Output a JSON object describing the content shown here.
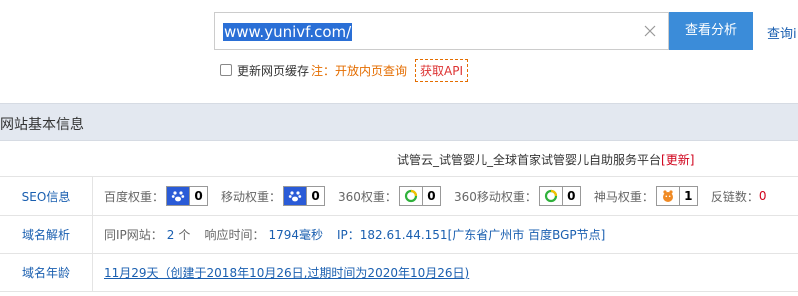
{
  "search": {
    "value": "www.yunivf.com/",
    "button_label": "查看分析",
    "query_link": "查询i"
  },
  "options": {
    "cache_label": "更新网页缓存",
    "note": "注：开放内页查询",
    "api_label": "获取API"
  },
  "section": {
    "title": "网站基本信息"
  },
  "site": {
    "title": "试管云_试管婴儿_全球首家试管婴儿自助服务平台",
    "update_label": "[更新]"
  },
  "seo": {
    "label": "SEO信息",
    "metrics": [
      {
        "label": "百度权重：",
        "icon": "paw-icon",
        "value": "0"
      },
      {
        "label": "移动权重：",
        "icon": "paw-icon",
        "value": "0"
      },
      {
        "label": "360权重：",
        "icon": "360-icon",
        "value": "0"
      },
      {
        "label": "360移动权重：",
        "icon": "360-icon",
        "value": "0"
      },
      {
        "label": "神马权重：",
        "icon": "shenma-icon",
        "value": "1"
      }
    ],
    "backlinks_label": "反链数：",
    "backlinks_value": "0"
  },
  "dns": {
    "label": "域名解析",
    "same_ip_label": "同IP网站：",
    "same_ip_value": "2",
    "same_ip_unit": "个",
    "response_label": "响应时间：",
    "response_value": "1794毫秒",
    "ip_text": "IP：182.61.44.151[广东省广州市 百度BGP节点]"
  },
  "age": {
    "label": "域名年龄",
    "text": "11月29天（创建于2018年10月26日,过期时间为2020年10月26日)"
  },
  "colors": {
    "accent": "#3b8cd9",
    "link": "#1a5fb0",
    "note": "#e46d00",
    "update": "#d0021b",
    "section_bg": "#e3e8f0"
  }
}
